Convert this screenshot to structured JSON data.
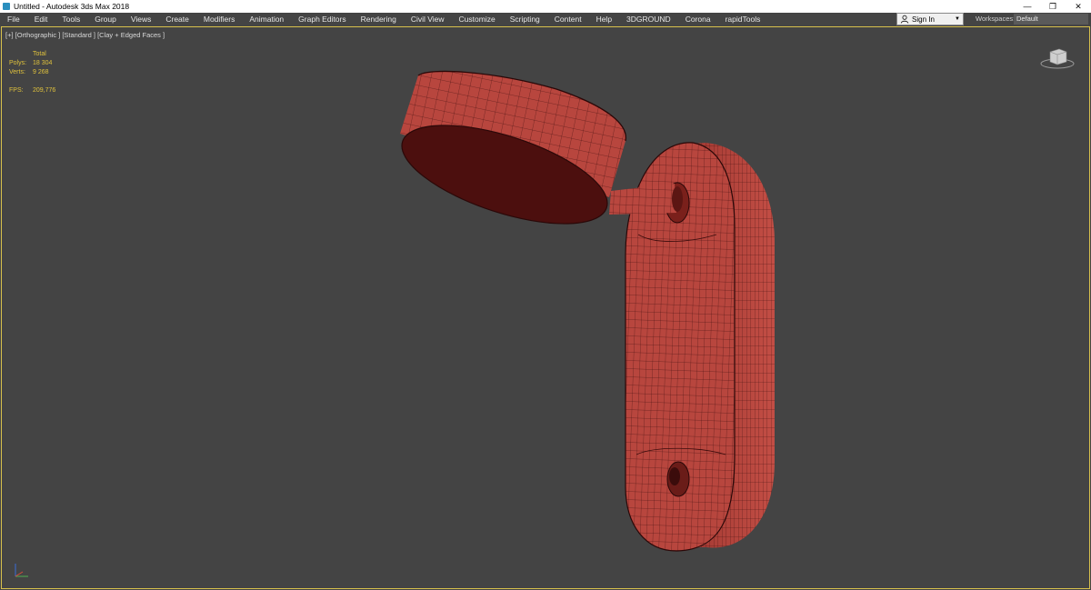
{
  "window": {
    "title": "Untitled - Autodesk 3ds Max 2018",
    "controls": {
      "minimize": "—",
      "restore": "❐",
      "close": "✕"
    }
  },
  "menu": [
    "File",
    "Edit",
    "Tools",
    "Group",
    "Views",
    "Create",
    "Modifiers",
    "Animation",
    "Graph Editors",
    "Rendering",
    "Civil View",
    "Customize",
    "Scripting",
    "Content",
    "Help",
    "3DGROUND",
    "Corona",
    "rapidTools"
  ],
  "signin": {
    "label": "Sign In"
  },
  "workspaces": {
    "label": "Workspaces:",
    "value": "Default"
  },
  "viewport": {
    "label": "[+] [Orthographic ] [Standard ] [Clay + Edged Faces ]",
    "stats": {
      "header": "Total",
      "polys_label": "Polys:",
      "polys_value": "18 304",
      "verts_label": "Verts:",
      "verts_value": "9 268",
      "fps_label": "FPS:",
      "fps_value": "209,776"
    }
  },
  "colors": {
    "viewport_bg": "#444444",
    "active_border": "#d8c14c",
    "stats_text": "#e0c23c",
    "clay": "#b8473f",
    "clay_dark": "#5a1414",
    "wire": "#3a0c0c"
  }
}
